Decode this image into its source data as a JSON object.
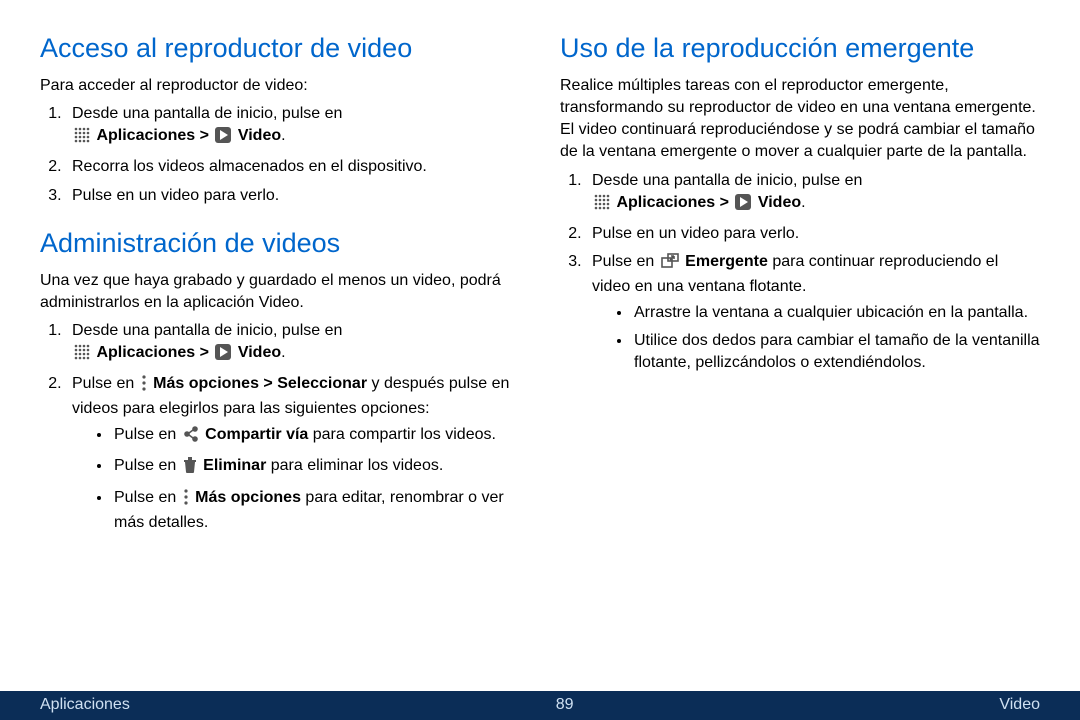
{
  "left": {
    "s1": {
      "heading": "Acceso al reproductor de video",
      "intro": "Para acceder al reproductor de video:",
      "step1_a": "Desde una pantalla de inicio, pulse en",
      "step1_b": "Aplicaciones",
      "step1_c": " > ",
      "step1_d": "Video",
      "step1_e": ".",
      "step2": "Recorra los videos almacenados en el dispositivo.",
      "step3": "Pulse en un video para verlo."
    },
    "s2": {
      "heading": "Administración de videos",
      "intro": "Una vez que haya grabado y guardado el menos un video, podrá administrarlos en la aplicación Video.",
      "step1_a": "Desde una pantalla de inicio, pulse en",
      "step1_b": "Aplicaciones",
      "step1_c": " > ",
      "step1_d": "Video",
      "step1_e": ".",
      "step2_a": "Pulse en ",
      "step2_b": "Más opciones > Seleccionar",
      "step2_c": " y después pulse en videos para elegirlos para las siguientes opciones:",
      "b1_a": "Pulse en ",
      "b1_b": "Compartir vía",
      "b1_c": " para compartir los videos.",
      "b2_a": "Pulse en ",
      "b2_b": "Eliminar",
      "b2_c": " para eliminar los videos.",
      "b3_a": "Pulse en ",
      "b3_b": "Más opciones",
      "b3_c": " para editar, renombrar o ver más detalles."
    }
  },
  "right": {
    "s1": {
      "heading": "Uso de la reproducción emergente",
      "intro": "Realice múltiples tareas con el reproductor emergente, transformando su reproductor de video en una ventana emergente. El video continuará reproduciéndose y se podrá cambiar el tamaño de la ventana emergente o mover a cualquier parte de la pantalla.",
      "step1_a": "Desde una pantalla de inicio, pulse en",
      "step1_b": "Aplicaciones",
      "step1_c": " > ",
      "step1_d": "Video",
      "step1_e": ".",
      "step2": "Pulse en un video para verlo.",
      "step3_a": "Pulse en ",
      "step3_b": "Emergente",
      "step3_c": " para continuar reproduciendo el video en una ventana flotante.",
      "b1": "Arrastre la ventana a cualquier ubicación en la pantalla.",
      "b2": "Utilice dos dedos para cambiar el tamaño de la ventanilla flotante, pellizcándolos o extendiéndolos."
    }
  },
  "footer": {
    "left": "Aplicaciones",
    "center": "89",
    "right": "Video"
  }
}
